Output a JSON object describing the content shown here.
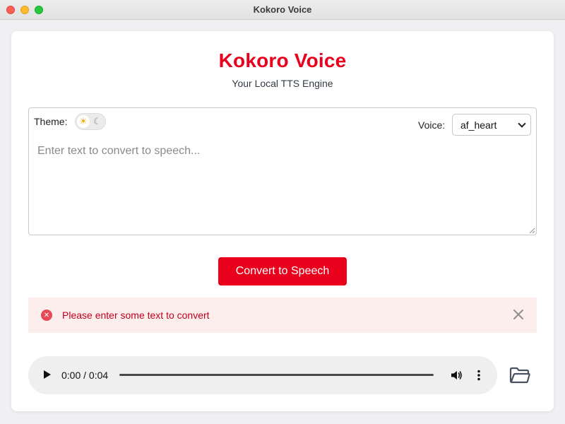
{
  "window": {
    "title": "Kokoro Voice"
  },
  "header": {
    "title": "Kokoro Voice",
    "subtitle": "Your Local TTS Engine"
  },
  "controls": {
    "theme_label": "Theme:",
    "theme_light_icon": "sun-icon",
    "theme_dark_icon": "moon-icon",
    "voice_label": "Voice:",
    "voice_selected": "af_heart"
  },
  "editor": {
    "placeholder": "Enter text to convert to speech...",
    "value": ""
  },
  "actions": {
    "convert_label": "Convert to Speech"
  },
  "error": {
    "message": "Please enter some text to convert"
  },
  "player": {
    "time": "0:00 / 0:04",
    "progress": 0
  },
  "colors": {
    "accent": "#e8001c",
    "error_bg": "#fdeeee",
    "error_text": "#c0001a"
  }
}
